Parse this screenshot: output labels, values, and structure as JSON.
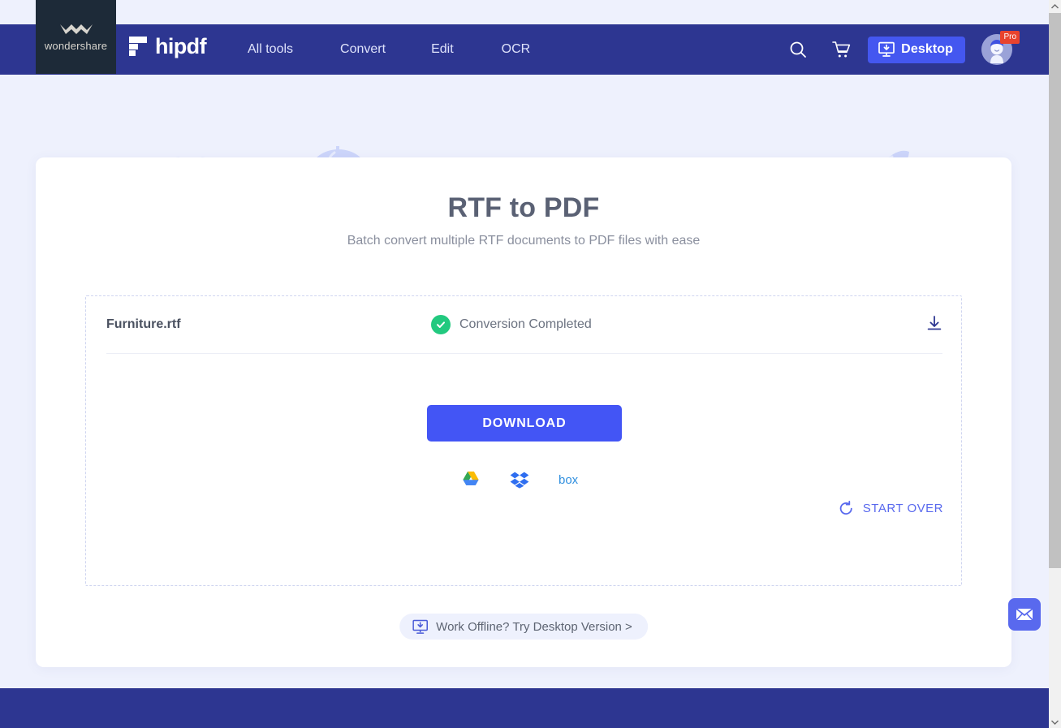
{
  "brand": {
    "wondershare": "wondershare",
    "product": "hipdf"
  },
  "header": {
    "nav": [
      {
        "label": "All tools"
      },
      {
        "label": "Convert"
      },
      {
        "label": "Edit"
      },
      {
        "label": "OCR"
      }
    ],
    "search_icon": "search-icon",
    "cart_icon": "cart-icon",
    "desktop_button": "Desktop",
    "account_badge": "Pro",
    "bg_color": "#2d3691"
  },
  "main": {
    "title": "RTF to PDF",
    "subtitle": "Batch convert multiple RTF documents to PDF files with ease",
    "file": {
      "name": "Furniture.rtf",
      "status": "Conversion Completed",
      "status_color": "#22c97f",
      "download_icon": "download-icon"
    },
    "download_button": "DOWNLOAD",
    "download_button_color": "#4355f5",
    "cloud_targets": [
      {
        "name": "google-drive",
        "label": "Google Drive"
      },
      {
        "name": "dropbox",
        "label": "Dropbox"
      },
      {
        "name": "box",
        "label": "Box"
      }
    ],
    "start_over": "START OVER",
    "offline_chip": "Work Offline? Try Desktop Version >"
  },
  "widgets": {
    "mail": "mail-widget"
  }
}
